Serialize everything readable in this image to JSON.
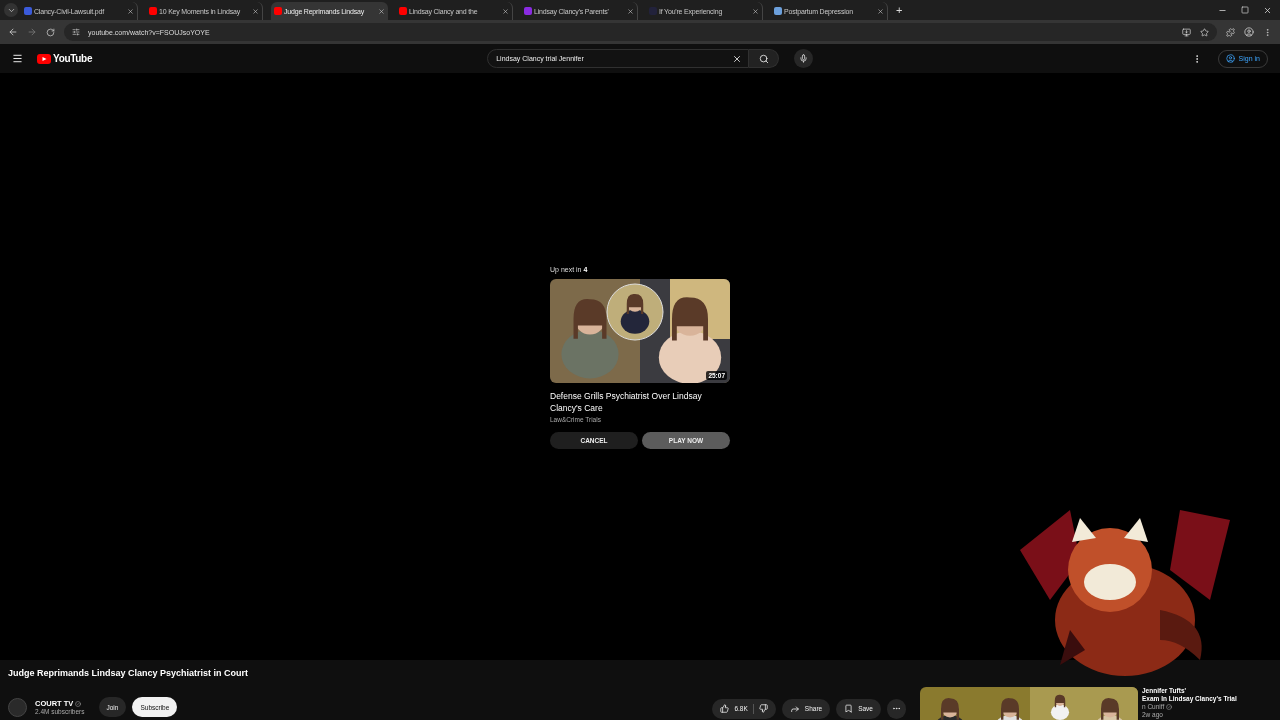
{
  "browser": {
    "tabs": [
      {
        "title": "Clancy-Civil-Lawsuit.pdf",
        "selected": false,
        "kind": "pdf"
      },
      {
        "title": "10 Key Moments in Lindsay",
        "selected": false,
        "kind": "youtube"
      },
      {
        "title": "Judge Reprimands Lindsay",
        "selected": true,
        "kind": "youtube"
      },
      {
        "title": "Lindsay Clancy and the",
        "selected": false,
        "kind": "youtube"
      },
      {
        "title": "Lindsay Clancy's Parents'",
        "selected": false,
        "kind": "slash"
      },
      {
        "title": "If You're Experiencing",
        "selected": false,
        "kind": "dark"
      },
      {
        "title": "Postpartum Depression",
        "selected": false,
        "kind": "health"
      }
    ],
    "new_tab": "+",
    "address": "youtube.com/watch?v=FSOUJsoYOYE"
  },
  "header": {
    "logo": "YouTube",
    "search": "Lindsay Clancy trial Jennifer",
    "sign_in": "Sign in"
  },
  "up_next": {
    "label": "Up next in **4**",
    "duration": "25:07",
    "title": "Defense Grills Psychiatrist Over Lindsay Clancy's Care",
    "channel": "Law&Crime Trials",
    "cancel": "CANCEL",
    "play": "PLAY NOW"
  },
  "video": {
    "title": "Judge Reprimands Lindsay Clancy Psychiatrist in Court",
    "channel": "COURT TV",
    "verified": true,
    "subscribers": "2.4M subscribers",
    "join": "Join",
    "subscribe": "Subscribe",
    "likes": "6.8K",
    "share": "Share",
    "save": "Save"
  },
  "recommendation": {
    "kind": "picture",
    "title_lines": [
      "Jennifer Tufts'",
      "Exam In Lindsay Clancy's Trial"
    ],
    "channel": "n Cuniff",
    "verified": true,
    "meta": "2w ago"
  }
}
